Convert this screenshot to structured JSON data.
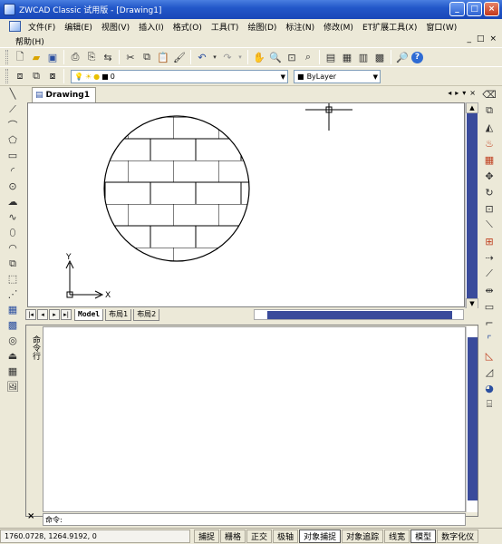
{
  "window": {
    "title": "ZWCAD Classic 试用版 - [Drawing1]",
    "minimize": "_",
    "maximize": "□",
    "close": "×"
  },
  "menu": {
    "items": [
      "文件(F)",
      "编辑(E)",
      "视图(V)",
      "插入(I)",
      "格式(O)",
      "工具(T)",
      "绘图(D)",
      "标注(N)",
      "修改(M)",
      "ET扩展工具(X)",
      "窗口(W)"
    ],
    "help": "帮助(H)",
    "mdi_controls": [
      "_",
      "□",
      "×"
    ]
  },
  "layer_toolbar": {
    "layer_value": "0",
    "color_value": "ByLayer"
  },
  "document": {
    "tab_label": "Drawing1",
    "nav": [
      "◂",
      "▸",
      "▾",
      "×"
    ]
  },
  "layouts": {
    "tabs": [
      "Model",
      "布局1",
      "布局2"
    ],
    "active": "Model"
  },
  "ucs": {
    "x_label": "X",
    "y_label": "Y"
  },
  "command": {
    "side_label": "命令行",
    "prompt": "命令:",
    "close": "×"
  },
  "status": {
    "coords": "1760.0728,  1264.9192,  0",
    "buttons": [
      "捕捉",
      "栅格",
      "正交",
      "极轴",
      "对象捕捉",
      "对象追踪",
      "线宽",
      "模型",
      "数字化仪"
    ],
    "active_buttons": [
      "对象捕捉",
      "模型"
    ]
  },
  "colors": {
    "title_bar": "#2358c9",
    "scroll_thumb": "#3a4b9b",
    "canvas": "#ffffff"
  }
}
